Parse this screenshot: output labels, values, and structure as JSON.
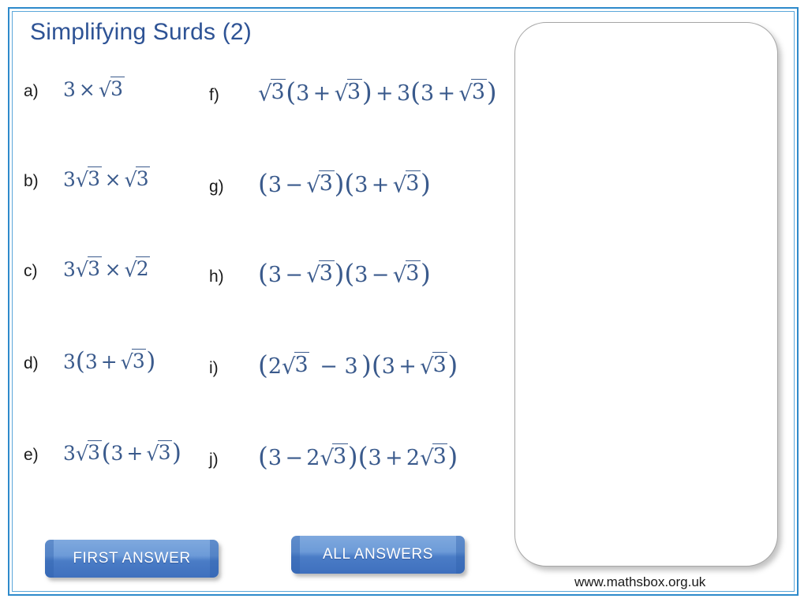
{
  "slide": {
    "title": "Simplifying Surds (2)",
    "footer": "www.mathsbox.org.uk",
    "border_color_outer": "#2E8ACB",
    "border_color_inner": "#5BA7DA",
    "title_color": "#2E5395",
    "expression_color": "#3A5A8C",
    "background": "#FFFFFF"
  },
  "questions": {
    "left_column": [
      {
        "label": "a)",
        "expression": "3 × √3"
      },
      {
        "label": "b)",
        "expression": "3√3 × √3"
      },
      {
        "label": "c)",
        "expression": "3√3 × √2"
      },
      {
        "label": "d)",
        "expression": "3(3 + √3)"
      },
      {
        "label": "e)",
        "expression": "3√3(3 + √3)"
      }
    ],
    "right_column": [
      {
        "label": "f)",
        "expression": "√3(3 + √3) + 3(3 + √3)"
      },
      {
        "label": "g)",
        "expression": "(3 − √3)(3 + √3)"
      },
      {
        "label": "h)",
        "expression": "(3 − √3)(3 − √3)"
      },
      {
        "label": "i)",
        "expression": "(2√3 − 3)(3 + √3)"
      },
      {
        "label": "j)",
        "expression": "(3 − 2√3)(3 + 2√3)"
      }
    ]
  },
  "buttons": {
    "first_answer": "FIRST ANSWER",
    "all_answers": "ALL ANSWERS",
    "color_top": "#7FA9DE",
    "color_bottom": "#3F70BE",
    "text_color": "#FFFFFF"
  },
  "answer_panel": {
    "content": "",
    "border_color": "#A6A6A6",
    "background": "#FFFFFF"
  }
}
